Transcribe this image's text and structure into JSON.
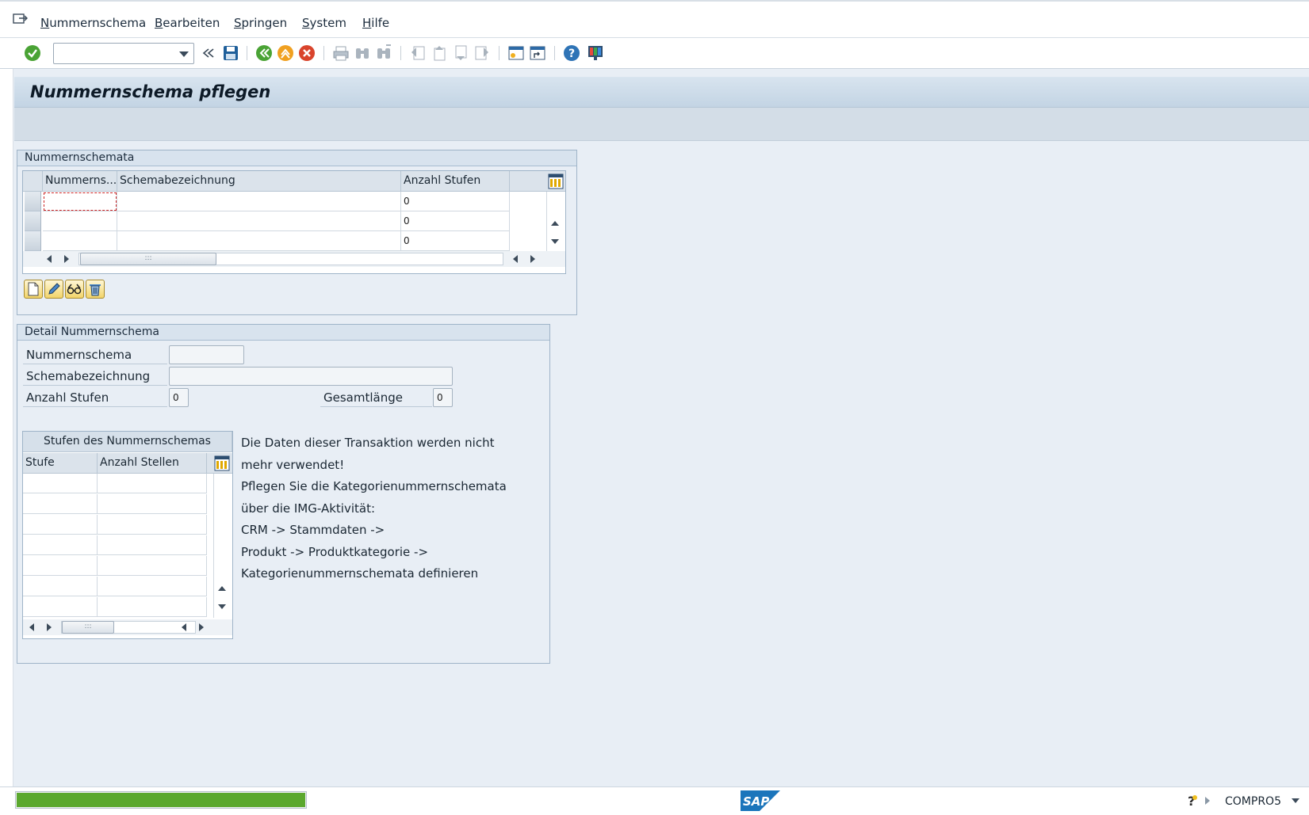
{
  "menubar": {
    "items": [
      "Nummernschema",
      "Bearbeiten",
      "Springen",
      "System",
      "Hilfe"
    ]
  },
  "toolbar": {
    "command_value": "",
    "icons": [
      "enter-icon",
      "back-nav-icon",
      "save-icon",
      "back-icon",
      "exit-icon",
      "cancel-icon",
      "print-icon",
      "find-icon",
      "find-next-icon",
      "first-page-icon",
      "previous-page-icon",
      "next-page-icon",
      "last-page-icon",
      "new-session-icon",
      "shortcut-icon",
      "help-icon",
      "customize-layout-icon"
    ]
  },
  "page": {
    "title": "Nummernschema pflegen"
  },
  "schemata_group": {
    "title": "Nummernschemata",
    "columns": [
      "Nummerns...",
      "Schemabezeichnung",
      "Anzahl Stufen"
    ],
    "rows": [
      {
        "nummernschema": "",
        "bezeichnung": "",
        "stufen": "0"
      },
      {
        "nummernschema": "",
        "bezeichnung": "",
        "stufen": "0"
      },
      {
        "nummernschema": "",
        "bezeichnung": "",
        "stufen": "0"
      }
    ],
    "buttons": [
      "create-icon",
      "edit-icon",
      "display-icon",
      "delete-icon"
    ]
  },
  "detail_group": {
    "title": "Detail Nummernschema",
    "fields": {
      "nummernschema_label": "Nummernschema",
      "nummernschema_value": "",
      "bezeichnung_label": "Schemabezeichnung",
      "bezeichnung_value": "",
      "anzahl_label": "Anzahl Stufen",
      "anzahl_value": "0",
      "gesamt_label": "Gesamtlänge",
      "gesamt_value": "0"
    },
    "stufen_table": {
      "title": "Stufen des Nummernschemas",
      "columns": [
        "Stufe",
        "Anzahl Stellen"
      ]
    },
    "info_lines": [
      "Die Daten dieser Transaktion werden nicht",
      "mehr verwendet!",
      "Pflegen Sie die Kategorienummernschemata",
      "über die IMG-Aktivität:",
      "CRM -> Stammdaten ->",
      "Produkt -> Produktkategorie ->",
      "Kategorienummernschemata definieren"
    ]
  },
  "statusbar": {
    "logo_text": "SAP",
    "system": "COMPRO5",
    "accent": "#5ba82e"
  }
}
